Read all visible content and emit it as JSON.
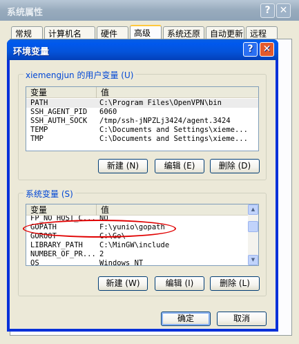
{
  "outer_window": {
    "title": "系统属性",
    "help_button": "?",
    "close_button": "✕",
    "tabs": [
      "常规",
      "计算机名",
      "硬件",
      "高级",
      "系统还原",
      "自动更新",
      "远程"
    ],
    "selected_tab": "高级"
  },
  "dialog": {
    "title": "环境变量",
    "help_button": "?",
    "close_button": "✕",
    "user_group_label": "xiemengjun 的用户变量 (U)",
    "system_group_label": "系统变量 (S)",
    "columns": [
      "变量",
      "值"
    ],
    "user_vars": [
      {
        "name": "PATH",
        "value": "C:\\Program Files\\OpenVPN\\bin"
      },
      {
        "name": "SSH_AGENT_PID",
        "value": "6060"
      },
      {
        "name": "SSH_AUTH_SOCK",
        "value": "/tmp/ssh-jNPZLj3424/agent.3424"
      },
      {
        "name": "TEMP",
        "value": "C:\\Documents and Settings\\xieme..."
      },
      {
        "name": "TMP",
        "value": "C:\\Documents and Settings\\xieme..."
      }
    ],
    "system_vars": [
      {
        "name": "FP_NO_HOST_C...",
        "value": "NO"
      },
      {
        "name": "GOPATH",
        "value": "F:\\yunio\\gopath"
      },
      {
        "name": "GOROOT",
        "value": "C:\\Go\\"
      },
      {
        "name": "LIBRARY_PATH",
        "value": "C:\\MinGW\\include"
      },
      {
        "name": "NUMBER_OF_PR...",
        "value": "2"
      },
      {
        "name": "OS",
        "value": "Windows_NT"
      }
    ],
    "user_buttons": {
      "new": "新建 (N)",
      "edit": "编辑 (E)",
      "delete": "删除 (D)"
    },
    "system_buttons": {
      "new": "新建 (W)",
      "edit": "编辑 (I)",
      "delete": "删除 (L)"
    },
    "ok_button": "确定",
    "cancel_button": "取消"
  },
  "colors": {
    "dialog_titlebar": "#0453d9",
    "group_label": "#0046d5",
    "annotation": "#e00000",
    "selected_row": "#ececec"
  }
}
